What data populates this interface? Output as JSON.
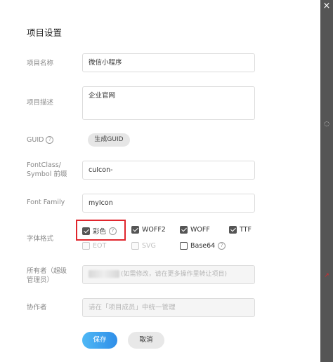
{
  "dialog": {
    "title": "项目设置",
    "close_glyph": "×"
  },
  "fields": {
    "name": {
      "label": "项目名称",
      "value": "微信小程序"
    },
    "desc": {
      "label": "项目描述",
      "value": "企业官网"
    },
    "guid": {
      "label": "GUID",
      "button": "生成GUID",
      "help": "?"
    },
    "font_class": {
      "label_line1": "FontClass/",
      "label_line2": "Symbol 前缀",
      "value": "cuIcon-"
    },
    "font_family": {
      "label": "Font Family",
      "value": "myIcon"
    },
    "format": {
      "label": "字体格式",
      "options": [
        {
          "label": "彩色",
          "checked": true,
          "help": "?"
        },
        {
          "label": "WOFF2",
          "checked": true
        },
        {
          "label": "WOFF",
          "checked": true
        },
        {
          "label": "TTF",
          "checked": true
        },
        {
          "label": "EOT",
          "checked": false,
          "disabled": true
        },
        {
          "label": "SVG",
          "checked": false,
          "disabled": true
        },
        {
          "label": "Base64",
          "checked": false,
          "help": "?"
        }
      ]
    },
    "owner": {
      "label_line1": "所有者（超级",
      "label_line2": "管理员）",
      "hint": "(如需修改，请在更多操作里转让项目)"
    },
    "collaborators": {
      "label": "协作者",
      "placeholder": "请在「项目成员」中统一管理"
    }
  },
  "actions": {
    "save": "保存",
    "cancel": "取消"
  },
  "edge_glyphs": {
    "upper": "◌",
    "lower": "↗"
  }
}
